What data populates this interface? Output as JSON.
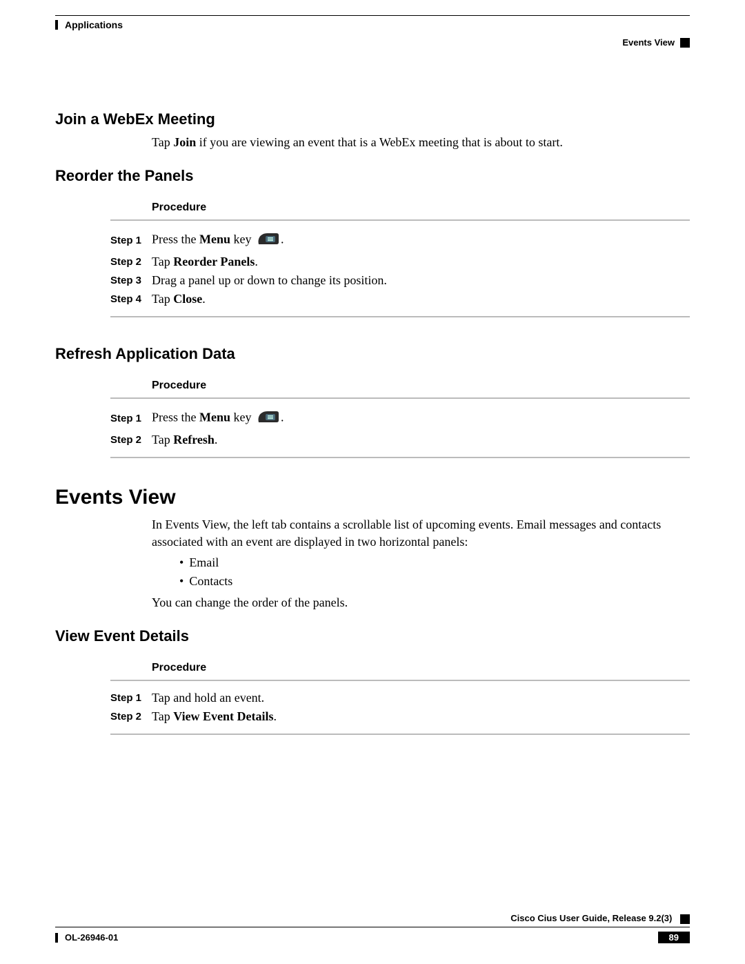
{
  "header": {
    "chapter": "Applications",
    "section": "Events View"
  },
  "s1": {
    "title": "Join a WebEx Meeting",
    "p_a": "Tap ",
    "p_bold": "Join",
    "p_b": " if you are viewing an event that is a WebEx meeting that is about to start."
  },
  "s2": {
    "title": "Reorder the Panels",
    "proc": "Procedure",
    "step1_label": "Step 1",
    "step1_a": "Press the ",
    "step1_bold": "Menu",
    "step1_b": " key ",
    "step1_c": ".",
    "step2_label": "Step 2",
    "step2_a": "Tap ",
    "step2_bold": "Reorder Panels",
    "step2_b": ".",
    "step3_label": "Step 3",
    "step3_text": "Drag a panel up or down to change its position.",
    "step4_label": "Step 4",
    "step4_a": "Tap ",
    "step4_bold": "Close",
    "step4_b": "."
  },
  "s3": {
    "title": "Refresh Application Data",
    "proc": "Procedure",
    "step1_label": "Step 1",
    "step1_a": "Press the ",
    "step1_bold": "Menu",
    "step1_b": " key ",
    "step1_c": ".",
    "step2_label": "Step 2",
    "step2_a": "Tap ",
    "step2_bold": "Refresh",
    "step2_b": "."
  },
  "s4": {
    "title": "Events View",
    "p1": "In Events View, the left tab contains a scrollable list of upcoming events. Email messages and contacts associated with an event are displayed in two horizontal panels:",
    "b1": "Email",
    "b2": "Contacts",
    "p2": "You can change the order of the panels."
  },
  "s5": {
    "title": "View Event Details",
    "proc": "Procedure",
    "step1_label": "Step 1",
    "step1_text": "Tap and hold an event.",
    "step2_label": "Step 2",
    "step2_a": "Tap ",
    "step2_bold": "View Event Details",
    "step2_b": "."
  },
  "footer": {
    "doc_id": "OL-26946-01",
    "guide": "Cisco Cius User Guide, Release 9.2(3)",
    "page": "89"
  }
}
